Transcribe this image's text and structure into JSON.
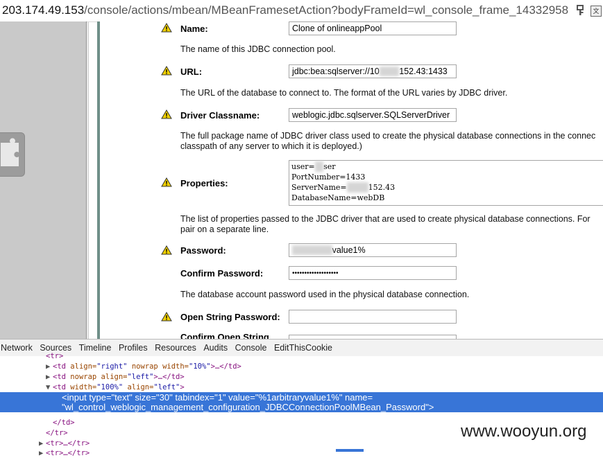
{
  "address_bar": {
    "host": "203.174.49.153",
    "path": "/console/actions/mbean/MBeanFramesetAction?bodyFrameId=wl_console_frame_14332958"
  },
  "form": {
    "name": {
      "label": "Name:",
      "value": "Clone of onlineappPool",
      "description": "The name of this JDBC connection pool."
    },
    "url": {
      "label": "URL:",
      "value_prefix": "jdbc:bea:sqlserver://10",
      "value_suffix": "152.43:1433",
      "description": "The URL of the database to connect to. The format of the URL varies by JDBC driver."
    },
    "driver": {
      "label": "Driver Classname:",
      "value": "weblogic.jdbc.sqlserver.SQLServerDriver",
      "description_line1": "The full package name of JDBC driver class used to create the physical database connections in the connec",
      "description_line2": "classpath of any server to which it is deployed.)"
    },
    "properties": {
      "label": "Properties:",
      "line1_prefix": "user=",
      "line1_suffix": "ser",
      "line2": "PortNumber=1433",
      "line3_prefix": "ServerName=",
      "line3_suffix": "152.43",
      "line4": "DatabaseName=webDB",
      "description_line1": "The list of properties passed to the JDBC driver that are used to create physical database connections. For",
      "description_line2": "pair on a separate line."
    },
    "password": {
      "label": "Password:",
      "value_suffix": "value1%"
    },
    "confirm_password": {
      "label": "Confirm Password:",
      "value": "•••••••••••••••••••",
      "description": "The database account password used in the physical database connection."
    },
    "open_string_password": {
      "label": "Open String Password:",
      "value": ""
    },
    "confirm_open_string": {
      "label": "Confirm Open String",
      "value": ""
    }
  },
  "devtools": {
    "tabs": [
      "Network",
      "Sources",
      "Timeline",
      "Profiles",
      "Resources",
      "Audits",
      "Console",
      "EditThisCookie"
    ],
    "tree": {
      "r0": "<tr>",
      "r1_tag_open": "<td ",
      "r1_a1": "align=",
      "r1_v1": "\"right\"",
      "r1_a2": " nowrap width=",
      "r1_v2": "\"10%\"",
      "r1_rest": ">…</td>",
      "r2_tag_open": "<td ",
      "r2_a1": "nowrap align=",
      "r2_v1": "\"left\"",
      "r2_rest": ">…</td>",
      "r3_tag_open": "<td ",
      "r3_a1": "width=",
      "r3_v1": "\"100%\"",
      "r3_a2": " align=",
      "r3_v2": "\"left\"",
      "r3_rest": ">",
      "sel_line1": "<input type=\"text\" size=\"30\" tabindex=\"1\" value=\"%1arbitraryvalue1%\" name=",
      "sel_line2": "\"wl_control_weblogic_management_configuration_JDBCConnectionPoolMBean_Password\">",
      "r4": "</td>",
      "r5": "</tr>",
      "r6": "<tr>…</tr>",
      "r7": "<tr>…</tr>"
    }
  },
  "watermark": "www.wooyun.org"
}
